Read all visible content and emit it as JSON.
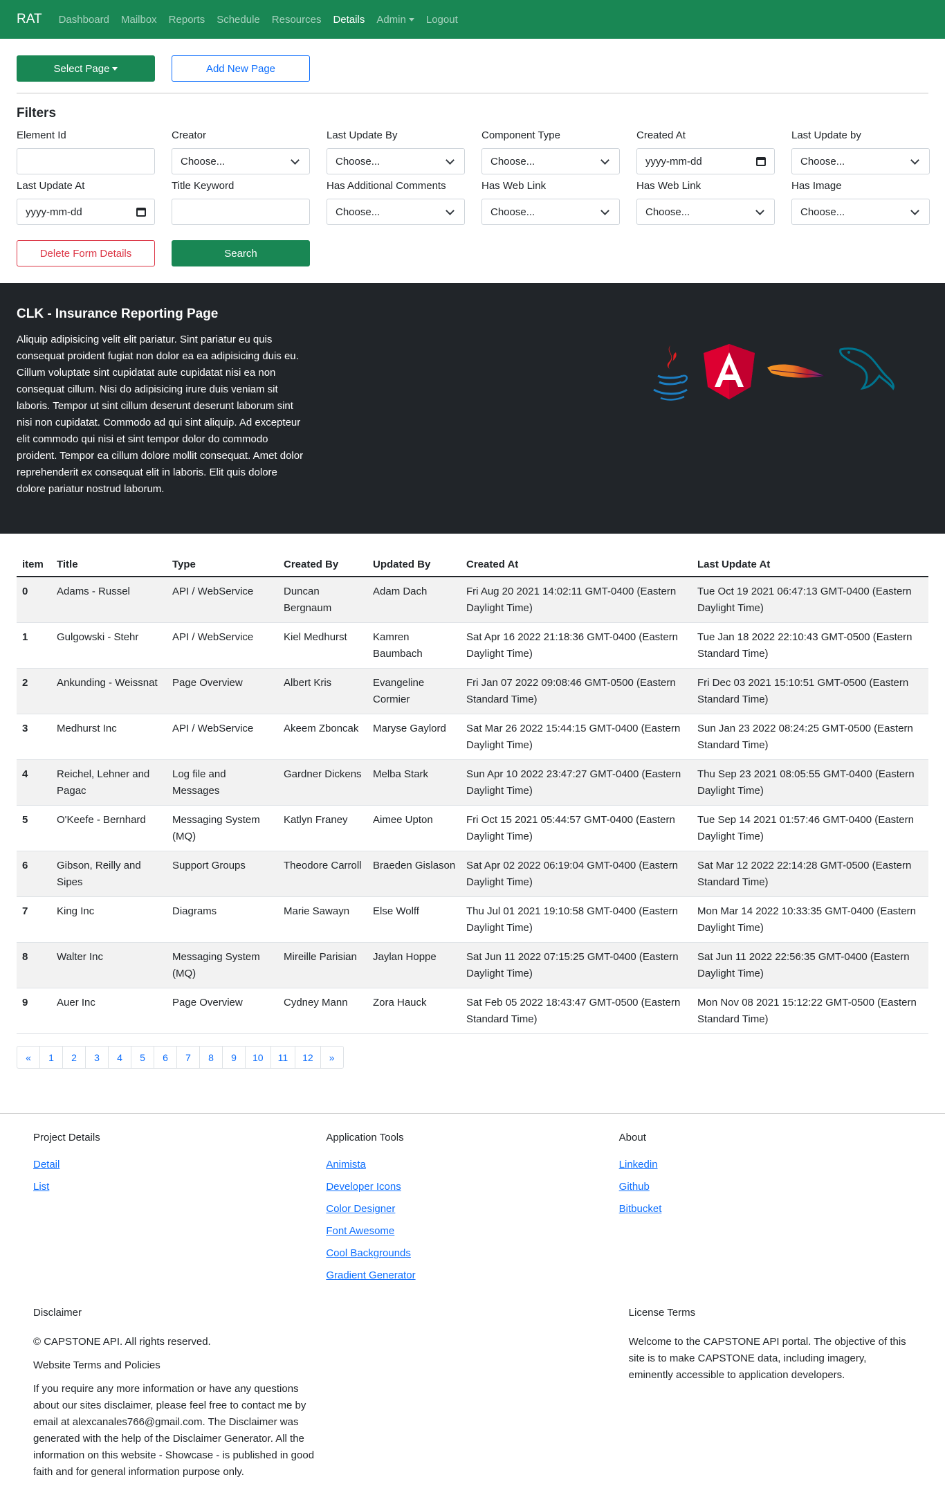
{
  "nav": {
    "brand": "RAT",
    "items": [
      {
        "label": "Dashboard",
        "active": false,
        "dropdown": false
      },
      {
        "label": "Mailbox",
        "active": false,
        "dropdown": false
      },
      {
        "label": "Reports",
        "active": false,
        "dropdown": false
      },
      {
        "label": "Schedule",
        "active": false,
        "dropdown": false
      },
      {
        "label": "Resources",
        "active": false,
        "dropdown": false
      },
      {
        "label": "Details",
        "active": true,
        "dropdown": false
      },
      {
        "label": "Admin",
        "active": false,
        "dropdown": true
      },
      {
        "label": "Logout",
        "active": false,
        "dropdown": false
      }
    ]
  },
  "actions": {
    "select_page": "Select Page",
    "add_new_page": "Add New Page"
  },
  "filters": {
    "title": "Filters",
    "fields": [
      {
        "label": "Element Id",
        "kind": "text",
        "value": ""
      },
      {
        "label": "Creator",
        "kind": "select",
        "value": "Choose..."
      },
      {
        "label": "Last Update By",
        "kind": "select",
        "value": "Choose..."
      },
      {
        "label": "Component Type",
        "kind": "select",
        "value": "Choose..."
      },
      {
        "label": "Created At",
        "kind": "date",
        "value": "yyyy-mm-dd"
      },
      {
        "label": "Last Update by",
        "kind": "select",
        "value": "Choose..."
      },
      {
        "label": "Last Update At",
        "kind": "date",
        "value": "yyyy-mm-dd"
      },
      {
        "label": "Title Keyword",
        "kind": "text",
        "value": ""
      },
      {
        "label": "Has Additional Comments",
        "kind": "select",
        "value": "Choose..."
      },
      {
        "label": "Has Web Link",
        "kind": "select",
        "value": "Choose..."
      },
      {
        "label": "Has Web Link",
        "kind": "select",
        "value": "Choose..."
      },
      {
        "label": "Has Image",
        "kind": "select",
        "value": "Choose..."
      }
    ],
    "delete_label": "Delete Form Details",
    "search_label": "Search"
  },
  "hero": {
    "title": "CLK - Insurance Reporting Page",
    "body": "Aliquip adipisicing velit elit pariatur. Sint pariatur eu quis consequat proident fugiat non dolor ea ea adipisicing duis eu. Cillum voluptate sint cupidatat aute cupidatat nisi ea non consequat cillum. Nisi do adipisicing irure duis veniam sit laboris. Tempor ut sint cillum deserunt deserunt laborum sint nisi non cupidatat. Commodo ad qui sint aliquip. Ad excepteur elit commodo qui nisi et sint tempor dolor do commodo proident. Tempor ea cillum dolore mollit consequat. Amet dolor reprehenderit ex consequat elit in laboris. Elit quis dolore dolore pariatur nostrud laborum.",
    "logos": [
      "java-icon",
      "angular-icon",
      "apache-feather-icon",
      "mysql-dolphin-icon"
    ],
    "colors": {
      "java_red": "#e11f21",
      "java_blue": "#1c7ec2",
      "angular_red": "#dd0031",
      "mysql_blue": "#00758f"
    }
  },
  "table": {
    "headers": [
      "item",
      "Title",
      "Type",
      "Created By",
      "Updated By",
      "Created At",
      "Last Update At"
    ],
    "rows": [
      [
        "0",
        "Adams - Russel",
        "API / WebService",
        "Duncan Bergnaum",
        "Adam Dach",
        "Fri Aug 20 2021 14:02:11 GMT-0400 (Eastern Daylight Time)",
        "Tue Oct 19 2021 06:47:13 GMT-0400 (Eastern Daylight Time)"
      ],
      [
        "1",
        "Gulgowski - Stehr",
        "API / WebService",
        "Kiel Medhurst",
        "Kamren Baumbach",
        "Sat Apr 16 2022 21:18:36 GMT-0400 (Eastern Daylight Time)",
        "Tue Jan 18 2022 22:10:43 GMT-0500 (Eastern Standard Time)"
      ],
      [
        "2",
        "Ankunding - Weissnat",
        "Page Overview",
        "Albert Kris",
        "Evangeline Cormier",
        "Fri Jan 07 2022 09:08:46 GMT-0500 (Eastern Standard Time)",
        "Fri Dec 03 2021 15:10:51 GMT-0500 (Eastern Standard Time)"
      ],
      [
        "3",
        "Medhurst Inc",
        "API / WebService",
        "Akeem Zboncak",
        "Maryse Gaylord",
        "Sat Mar 26 2022 15:44:15 GMT-0400 (Eastern Daylight Time)",
        "Sun Jan 23 2022 08:24:25 GMT-0500 (Eastern Standard Time)"
      ],
      [
        "4",
        "Reichel, Lehner and Pagac",
        "Log file and Messages",
        "Gardner Dickens",
        "Melba Stark",
        "Sun Apr 10 2022 23:47:27 GMT-0400 (Eastern Daylight Time)",
        "Thu Sep 23 2021 08:05:55 GMT-0400 (Eastern Daylight Time)"
      ],
      [
        "5",
        "O'Keefe - Bernhard",
        "Messaging System (MQ)",
        "Katlyn Franey",
        "Aimee Upton",
        "Fri Oct 15 2021 05:44:57 GMT-0400 (Eastern Daylight Time)",
        "Tue Sep 14 2021 01:57:46 GMT-0400 (Eastern Daylight Time)"
      ],
      [
        "6",
        "Gibson, Reilly and Sipes",
        "Support Groups",
        "Theodore Carroll",
        "Braeden Gislason",
        "Sat Apr 02 2022 06:19:04 GMT-0400 (Eastern Daylight Time)",
        "Sat Mar 12 2022 22:14:28 GMT-0500 (Eastern Standard Time)"
      ],
      [
        "7",
        "King Inc",
        "Diagrams",
        "Marie Sawayn",
        "Else Wolff",
        "Thu Jul 01 2021 19:10:58 GMT-0400 (Eastern Daylight Time)",
        "Mon Mar 14 2022 10:33:35 GMT-0400 (Eastern Daylight Time)"
      ],
      [
        "8",
        "Walter Inc",
        "Messaging System (MQ)",
        "Mireille Parisian",
        "Jaylan Hoppe",
        "Sat Jun 11 2022 07:15:25 GMT-0400 (Eastern Daylight Time)",
        "Sat Jun 11 2022 22:56:35 GMT-0400 (Eastern Daylight Time)"
      ],
      [
        "9",
        "Auer Inc",
        "Page Overview",
        "Cydney Mann",
        "Zora Hauck",
        "Sat Feb 05 2022 18:43:47 GMT-0500 (Eastern Standard Time)",
        "Mon Nov 08 2021 15:12:22 GMT-0500 (Eastern Standard Time)"
      ]
    ]
  },
  "pagination": [
    "«",
    "1",
    "2",
    "3",
    "4",
    "5",
    "6",
    "7",
    "8",
    "9",
    "10",
    "11",
    "12",
    "»"
  ],
  "footer": {
    "columns": [
      {
        "title": "Project Details",
        "links": [
          "Detail",
          "List"
        ]
      },
      {
        "title": "Application Tools",
        "links": [
          "Animista",
          "Developer Icons",
          "Color Designer",
          "Font Awesome",
          "Cool Backgrounds",
          "Gradient Generator"
        ]
      },
      {
        "title": "About",
        "links": [
          "Linkedin",
          "Github",
          "Bitbucket"
        ]
      }
    ],
    "disclaimer": {
      "title": "Disclaimer",
      "copyright": "© CAPSTONE API. All rights reserved.",
      "terms": "Website Terms and Policies",
      "body": "If you require any more information or have any questions about our sites disclaimer, please feel free to contact me by email at alexcanales766@gmail.com. The Disclaimer was generated with the help of the Disclaimer Generator. All the information on this website - Showcase - is published in good faith and for general information purpose only."
    },
    "license": {
      "title": "License Terms",
      "body": "Welcome to the CAPSTONE API portal. The objective of this site is to make CAPSTONE data, including imagery, eminently accessible to application developers."
    }
  },
  "theme": {
    "primary": "#0d6efd",
    "success": "#198754",
    "danger": "#dc3545",
    "dark": "#212529"
  }
}
